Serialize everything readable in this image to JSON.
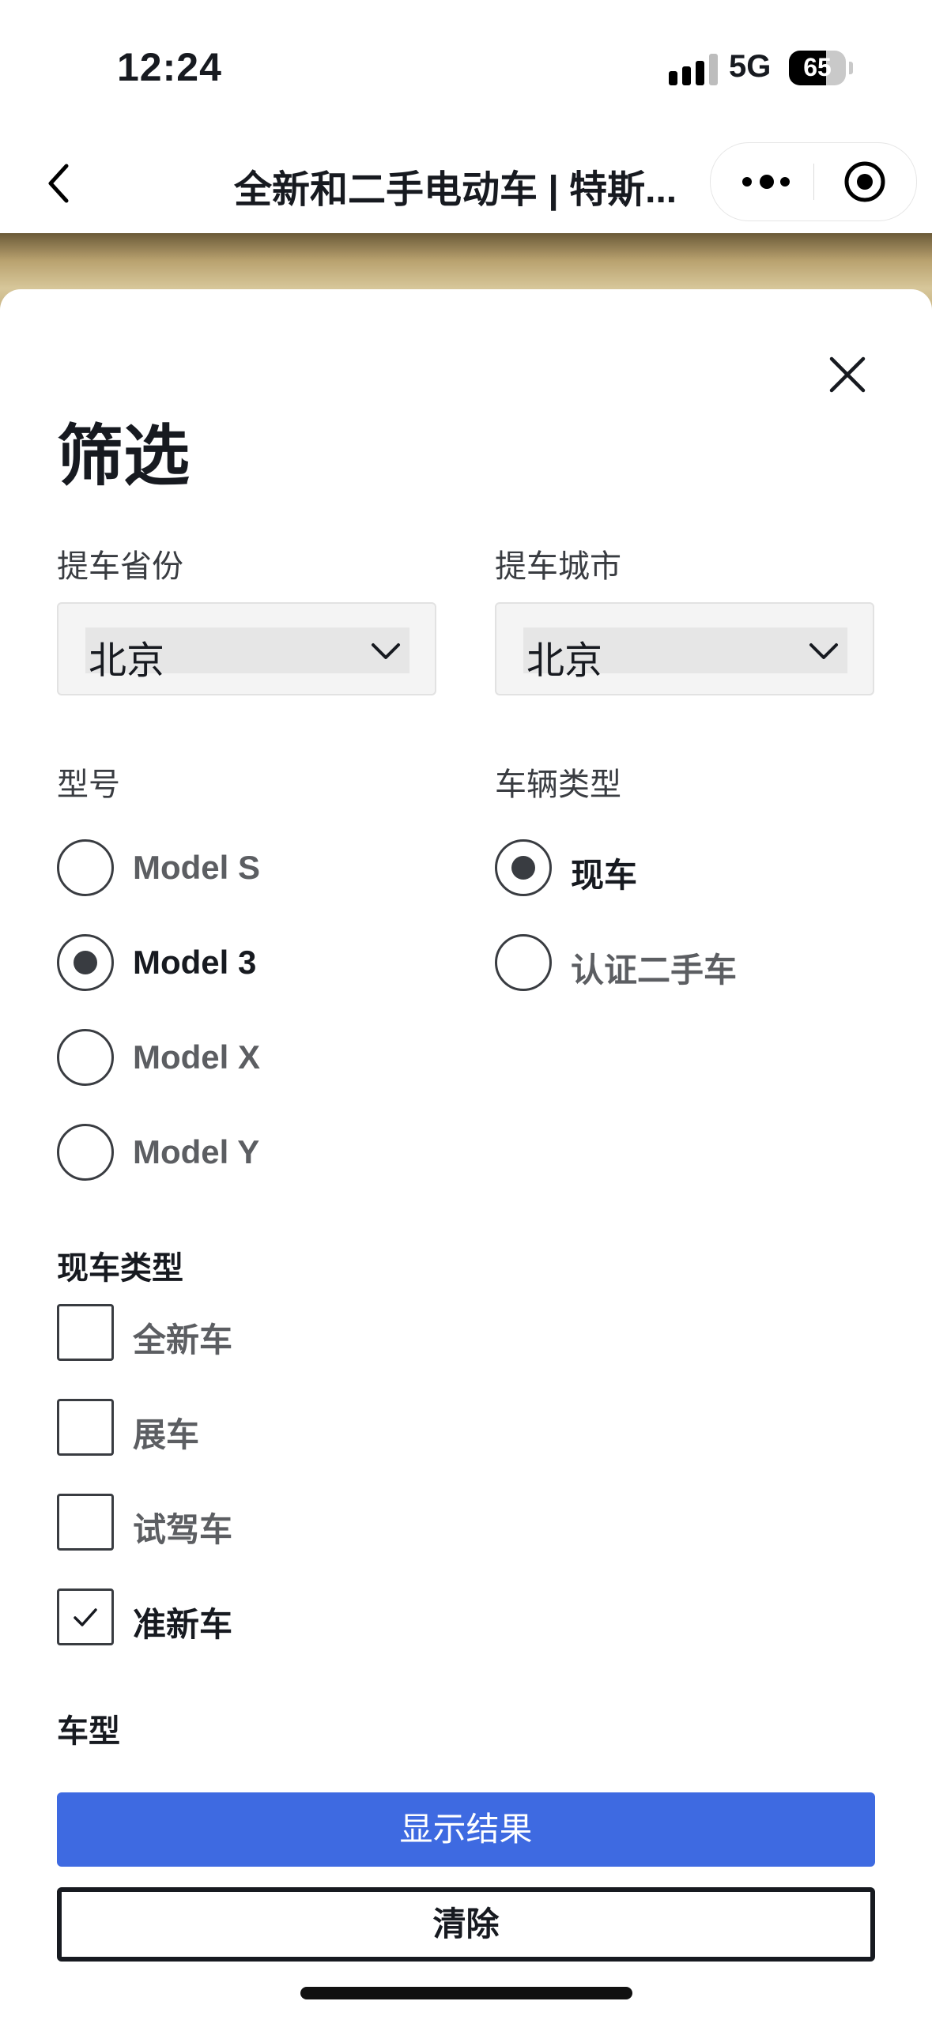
{
  "status_bar": {
    "time": "12:24",
    "network": "5G",
    "battery": "65",
    "battery_level": 0.65
  },
  "nav": {
    "title": "全新和二手电动车 | 特斯...",
    "back_icon": "chevron-left-icon",
    "more_icon": "more-dots-icon",
    "close_icon": "target-icon"
  },
  "filter": {
    "title": "筛选",
    "close_icon": "close-icon",
    "province": {
      "label": "提车省份",
      "value": "北京"
    },
    "city": {
      "label": "提车城市",
      "value": "北京"
    },
    "model": {
      "label": "型号",
      "options": [
        {
          "label": "Model S",
          "selected": false
        },
        {
          "label": "Model 3",
          "selected": true
        },
        {
          "label": "Model X",
          "selected": false
        },
        {
          "label": "Model Y",
          "selected": false
        }
      ]
    },
    "vehicle_type": {
      "label": "车辆类型",
      "options": [
        {
          "label": "现车",
          "selected": true
        },
        {
          "label": "认证二手车",
          "selected": false
        }
      ]
    },
    "inventory_type": {
      "label": "现车类型",
      "options": [
        {
          "label": "全新车",
          "checked": false
        },
        {
          "label": "展车",
          "checked": false
        },
        {
          "label": "试驾车",
          "checked": false
        },
        {
          "label": "准新车",
          "checked": true
        }
      ]
    },
    "trim_label": "车型",
    "show_results": "显示结果",
    "clear": "清除"
  },
  "colors": {
    "accent": "#3e6ae1",
    "text": "#171a20",
    "muted": "#5c5e62"
  }
}
